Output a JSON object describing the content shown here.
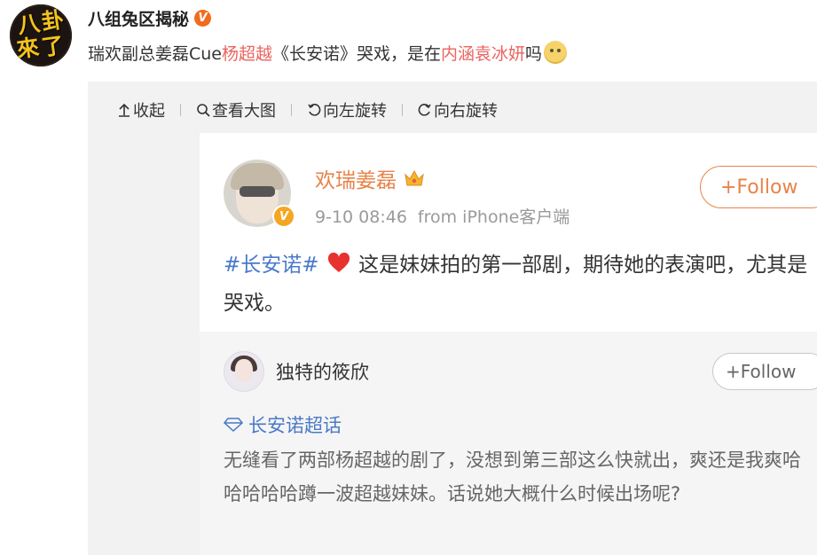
{
  "post": {
    "author": "八组兔区揭秘",
    "avatar_text": [
      "八",
      "卦",
      "來",
      "了"
    ],
    "verified_badge": "V",
    "text_prefix": "瑞欢副总姜磊Cue",
    "highlight_1": "杨超越",
    "text_middle": "《长安诺》哭戏，是在",
    "highlight_2": "内涵袁冰妍",
    "text_suffix": "吗",
    "emoji": "doge-emoji"
  },
  "toolbar": {
    "collapse": "收起",
    "view_large": "查看大图",
    "rotate_left": "向左旋转",
    "rotate_right": "向右旋转"
  },
  "screenshot": {
    "author": "欢瑞姜磊",
    "verified_badge": "V",
    "time": "9-10 08:46",
    "source": "from iPhone客户端",
    "follow_label": "+Follow",
    "hashtag": "#长安诺#",
    "text": "这是妹妹拍的第一部剧，期待她的表演吧，尤其是哭戏。",
    "reply": {
      "author": "独特的筱欣",
      "follow_label": "+Follow",
      "topic": "长安诺超话",
      "text": "无缝看了两部杨超越的剧了，没想到第三部这么快就出，爽还是我爽哈哈哈哈哈蹲一波超越妹妹。话说她大概什么时候出场呢?"
    }
  },
  "colors": {
    "highlight": "#eb6460",
    "orange": "#e8834a",
    "link_blue": "#4a79c8",
    "panel_gray": "#f2f2f2"
  }
}
